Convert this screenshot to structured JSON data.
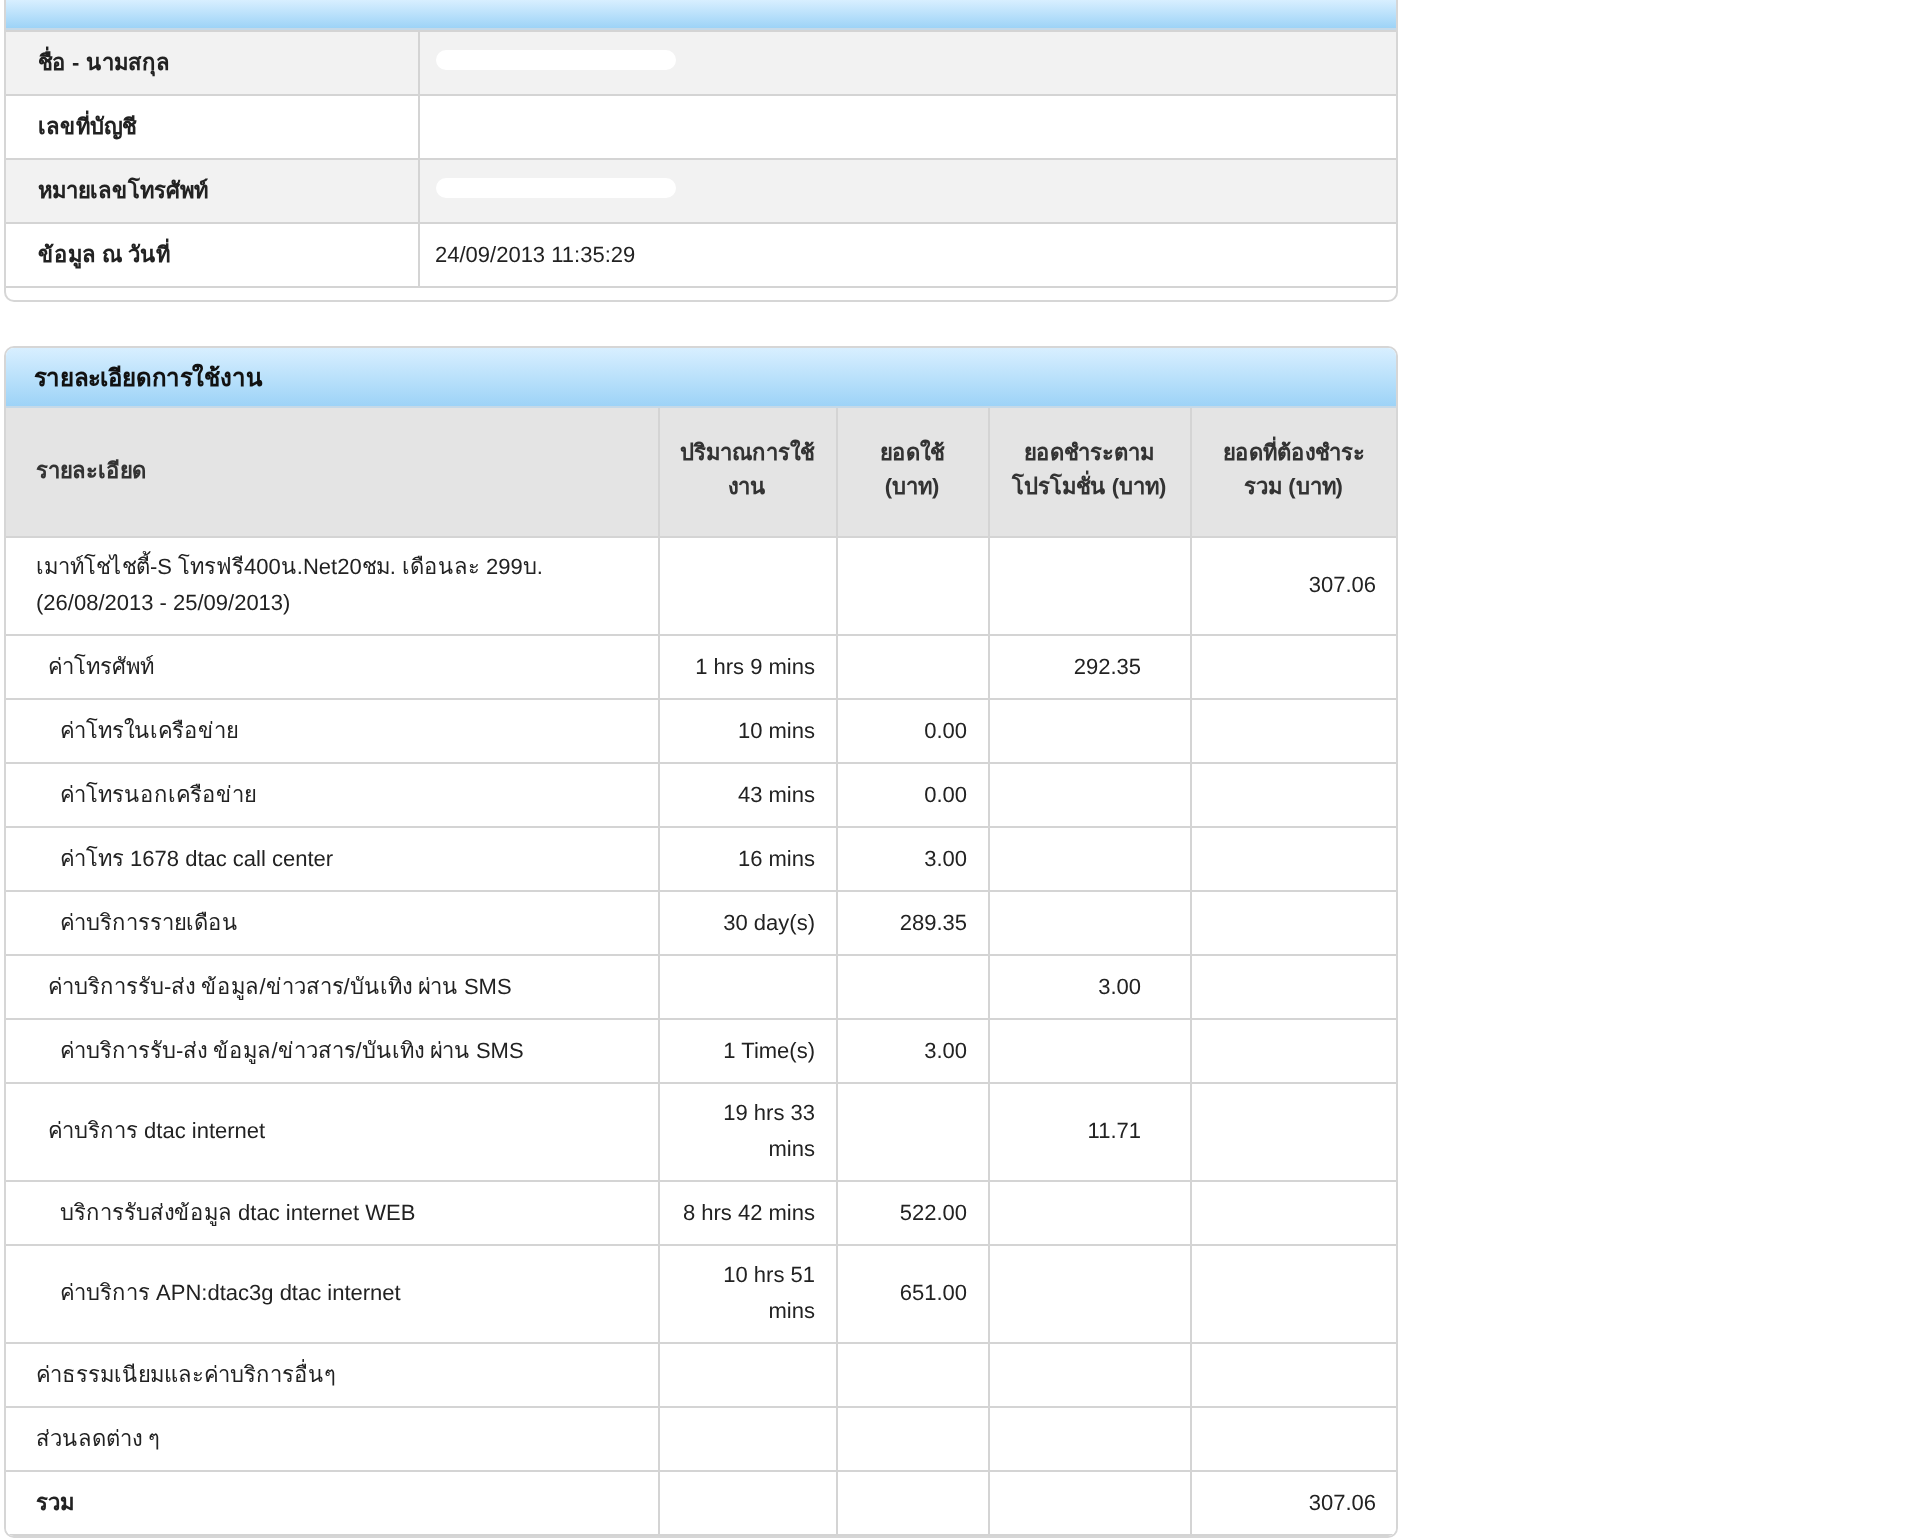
{
  "info_panel": {
    "rows": [
      {
        "label": "ชื่อ - นามสกุล",
        "redacted": true
      },
      {
        "label": "เลขที่บัญชี",
        "redacted": false
      },
      {
        "label": "หมายเลขโทรศัพท์",
        "redacted": true
      },
      {
        "label": "ข้อมูล ณ วันที่",
        "value": "24/09/2013 11:35:29",
        "redacted": false
      }
    ]
  },
  "usage_panel": {
    "title": "รายละเอียดการใช้งาน",
    "columns": [
      "รายละเอียด",
      "ปริมาณการใช้งาน",
      "ยอดใช้ (บาท)",
      "ยอดชำระตามโปรโมชั่น (บาท)",
      "ยอดที่ต้องชำระรวม (บาท)"
    ],
    "rows": [
      {
        "kind": "item",
        "detail": "เมาท์โชไชตี้-S โทรฟรี400น.Net20ชม. เดือนละ 299บ. (26/08/2013 - 25/09/2013)",
        "total": "307.06",
        "children": [
          {
            "kind": "item",
            "detail": "ค่าโทรศัพท์",
            "quantity": "1 hrs 9 mins",
            "promo": "292.35",
            "children": [
              {
                "kind": "item",
                "detail": "ค่าโทรในเครือข่าย",
                "quantity": "10 mins",
                "used": "0.00"
              },
              {
                "kind": "item",
                "detail": "ค่าโทรนอกเครือข่าย",
                "quantity": "43 mins",
                "used": "0.00"
              },
              {
                "kind": "item",
                "detail": "ค่าโทร 1678 dtac call center",
                "quantity": "16 mins",
                "used": "3.00"
              },
              {
                "kind": "item",
                "detail": "ค่าบริการรายเดือน",
                "quantity": "30 day(s)",
                "used": "289.35"
              }
            ]
          },
          {
            "kind": "item",
            "detail": "ค่าบริการรับ-ส่ง ข้อมูล/ข่าวสาร/บันเทิง ผ่าน SMS",
            "promo": "3.00",
            "children": [
              {
                "kind": "item",
                "detail": "ค่าบริการรับ-ส่ง ข้อมูล/ข่าวสาร/บันเทิง ผ่าน SMS",
                "quantity": "1 Time(s)",
                "used": "3.00"
              }
            ]
          },
          {
            "kind": "item",
            "detail": "ค่าบริการ dtac internet",
            "quantity": "19 hrs 33 mins",
            "promo": "11.71",
            "children": [
              {
                "kind": "item",
                "detail": "บริการรับส่งข้อมูล dtac internet WEB",
                "quantity": "8 hrs 42 mins",
                "used": "522.00"
              },
              {
                "kind": "item",
                "detail": "ค่าบริการ APN:dtac3g dtac internet",
                "quantity": "10 hrs 51 mins",
                "used": "651.00"
              }
            ]
          }
        ]
      },
      {
        "kind": "item",
        "detail": "ค่าธรรมเนียมและค่าบริการอื่นๆ"
      },
      {
        "kind": "item",
        "detail": "ส่วนลดต่าง ๆ"
      },
      {
        "kind": "total",
        "detail": "รวม",
        "total": "307.06"
      }
    ]
  }
}
